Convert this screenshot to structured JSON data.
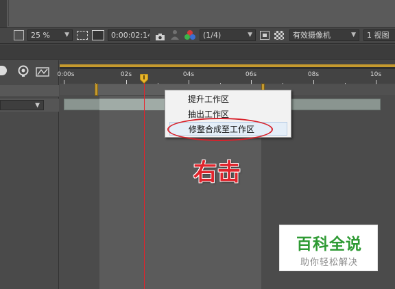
{
  "toolbar": {
    "zoom": "25 %",
    "timecode": "0:00:02:14",
    "resolution": "(1/4)",
    "camera": "有效摄像机",
    "views": "1 视图"
  },
  "ruler": {
    "labels": [
      {
        "text": "0:00s"
      },
      {
        "text": "02s"
      },
      {
        "text": "04s"
      },
      {
        "text": "06s"
      },
      {
        "text": "08s"
      },
      {
        "text": "10s"
      }
    ],
    "current_time_s": 2.56
  },
  "context_menu": {
    "items": [
      {
        "label": "提升工作区"
      },
      {
        "label": "抽出工作区"
      },
      {
        "label": "修整合成至工作区",
        "highlighted": true
      }
    ]
  },
  "annotation": {
    "text": "右击",
    "color": "#e0242c"
  },
  "watermark": {
    "title": "百科全说",
    "subtitle": "助你轻松解决",
    "title_color": "#2e9a33"
  },
  "icons": [
    "region-of-interest-icon",
    "transparency-grid-icon",
    "camera-snapshot-icon",
    "show-snapshot-icon",
    "channel-rgb-icon",
    "fast-preview-icon",
    "checkerboard-icon",
    "dropdown-arrow-icon",
    "current-time-indicator-icon"
  ]
}
